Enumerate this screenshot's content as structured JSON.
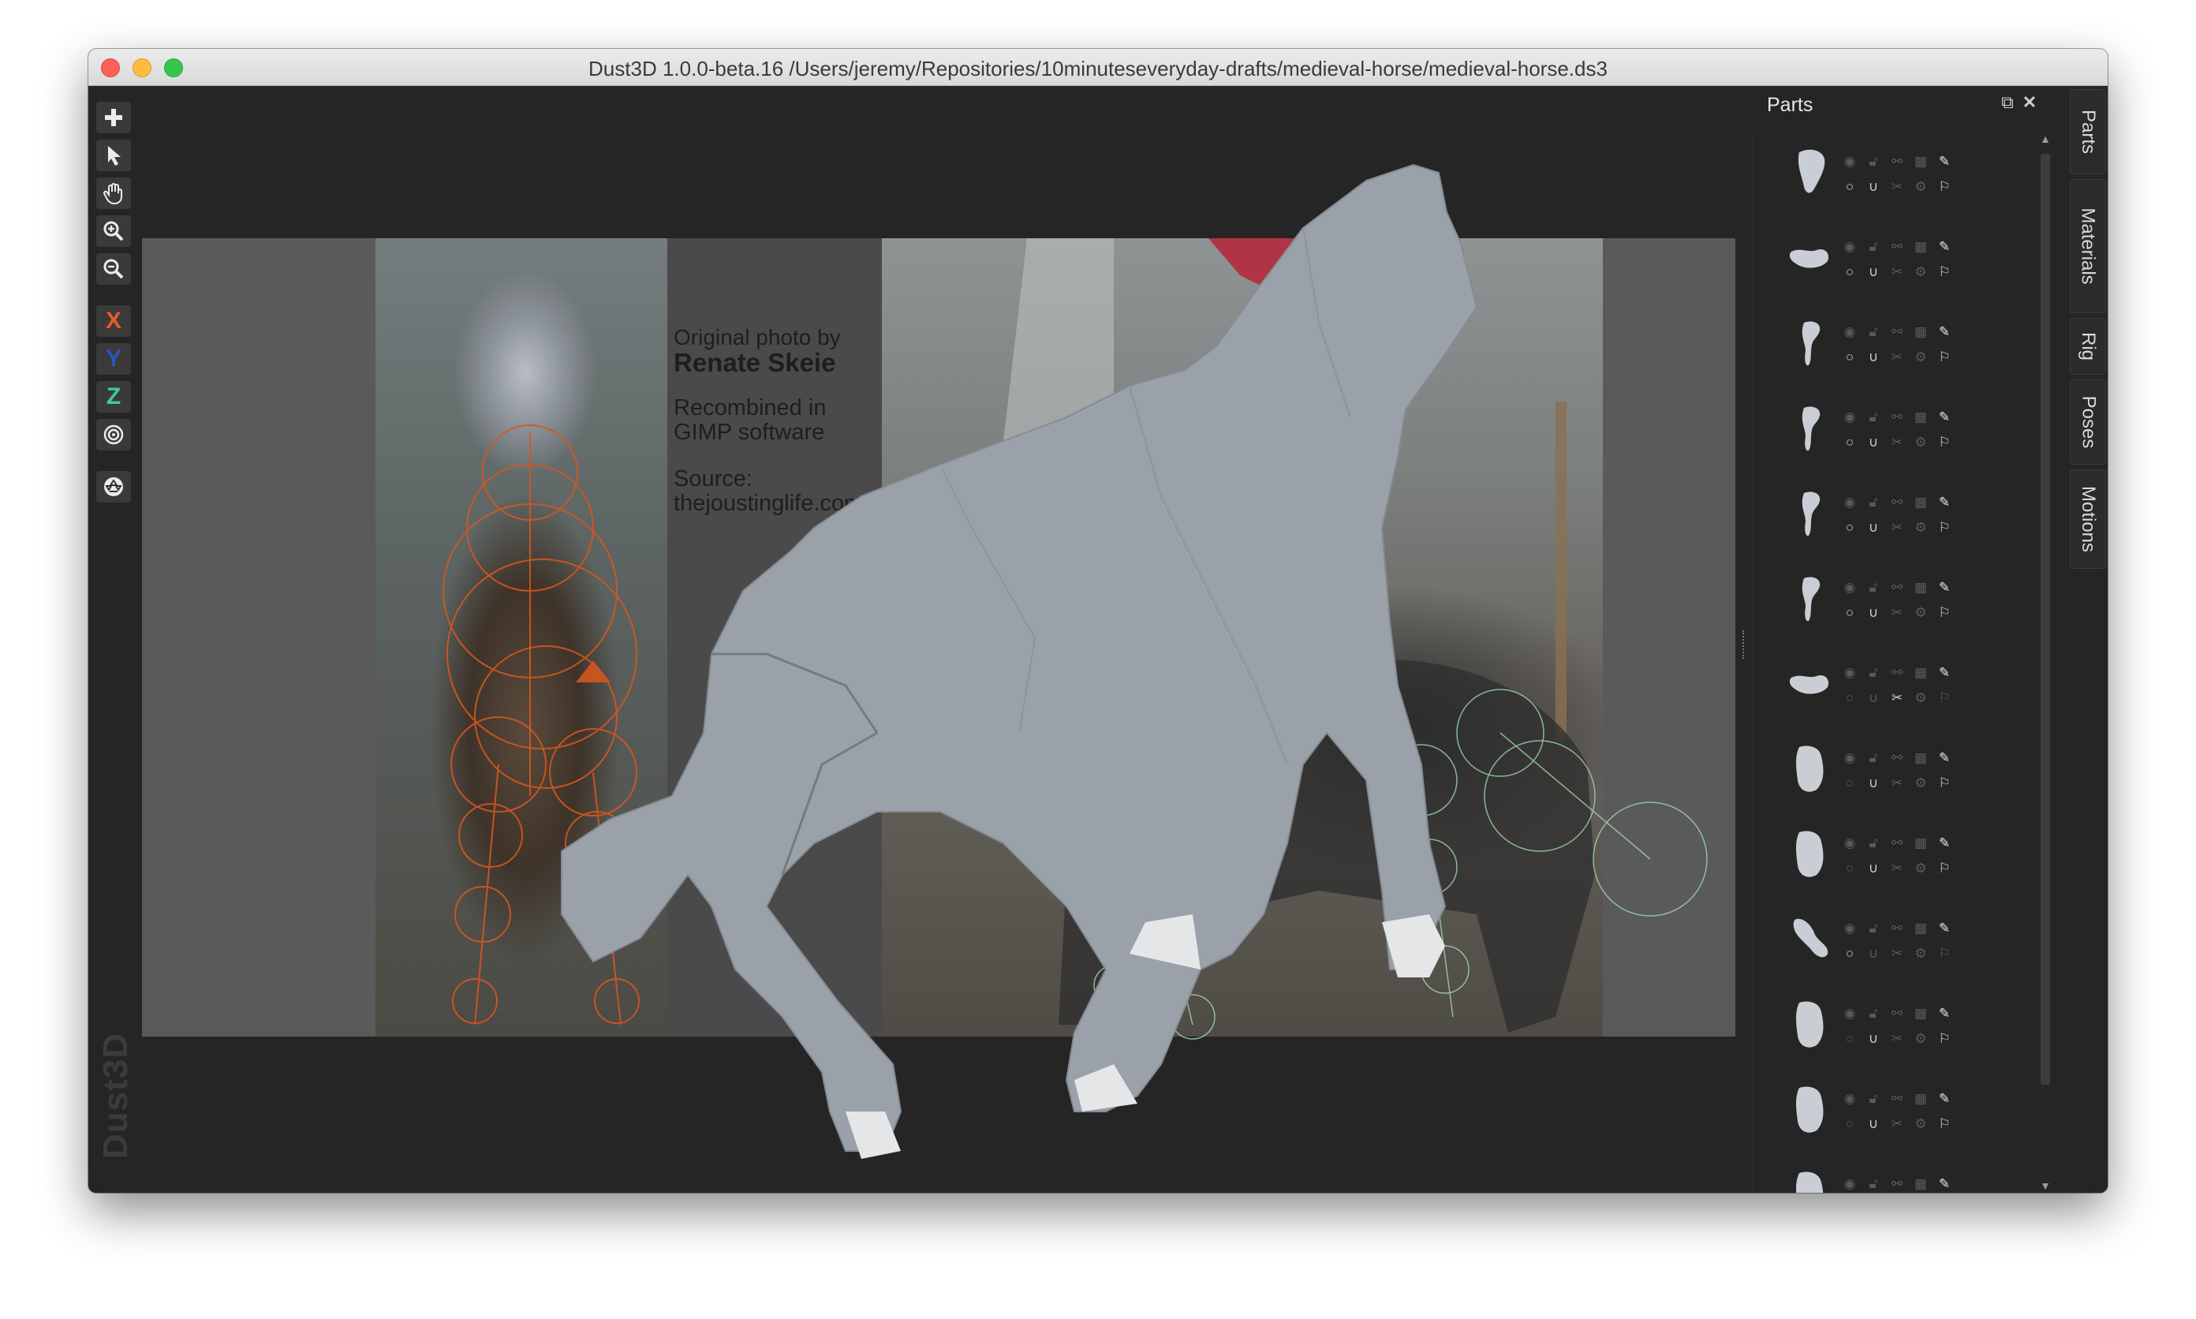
{
  "window": {
    "title": "Dust3D 1.0.0-beta.16 /Users/jeremy/Repositories/10minuteseveryday-drafts/medieval-horse/medieval-horse.ds3"
  },
  "toolbar": {
    "add_icon": "plus-icon",
    "select_icon": "arrow-cursor-icon",
    "pan_icon": "hand-icon",
    "zoom_in_icon": "zoom-in-icon",
    "zoom_out_icon": "zoom-out-icon",
    "x_label": "X",
    "y_label": "Y",
    "z_label": "Z",
    "x_color": "#e85a2a",
    "y_color": "#2c56b8",
    "z_color": "#41c9a0",
    "radius_icon": "target-icon",
    "regenerate_icon": "recycle-icon"
  },
  "watermark": "Dust3D",
  "reference_image": {
    "credit_line1": "Original photo by",
    "credit_name": "Renate Skeie",
    "recombined": "Recombined in GIMP software",
    "source": "Source: thejoustinglife.com"
  },
  "parts_panel": {
    "title": "Parts",
    "rows": [
      {
        "thumb": "head",
        "v": true,
        "sel": true
      },
      {
        "thumb": "hoof",
        "v": true,
        "sel": true
      },
      {
        "thumb": "leg",
        "v": true,
        "sel": true
      },
      {
        "thumb": "leg",
        "v": true,
        "sel": true
      },
      {
        "thumb": "leg",
        "v": true,
        "sel": true
      },
      {
        "thumb": "leg",
        "v": true,
        "sel": true
      },
      {
        "thumb": "hoof",
        "v": false,
        "sel": false
      },
      {
        "thumb": "body",
        "v": false,
        "sel": true
      },
      {
        "thumb": "body",
        "v": false,
        "sel": true
      },
      {
        "thumb": "tail",
        "v": true,
        "sel": false
      },
      {
        "thumb": "body",
        "v": false,
        "sel": true
      },
      {
        "thumb": "body",
        "v": false,
        "sel": true
      },
      {
        "thumb": "body",
        "v": false,
        "sel": false
      }
    ]
  },
  "tabs": [
    "Parts",
    "Materials",
    "Rig",
    "Poses",
    "Motions"
  ],
  "colors": {
    "bone_overlay": "#d4571f",
    "green_overlay": "#9fd9b5",
    "mesh": "#9ba1a9"
  }
}
